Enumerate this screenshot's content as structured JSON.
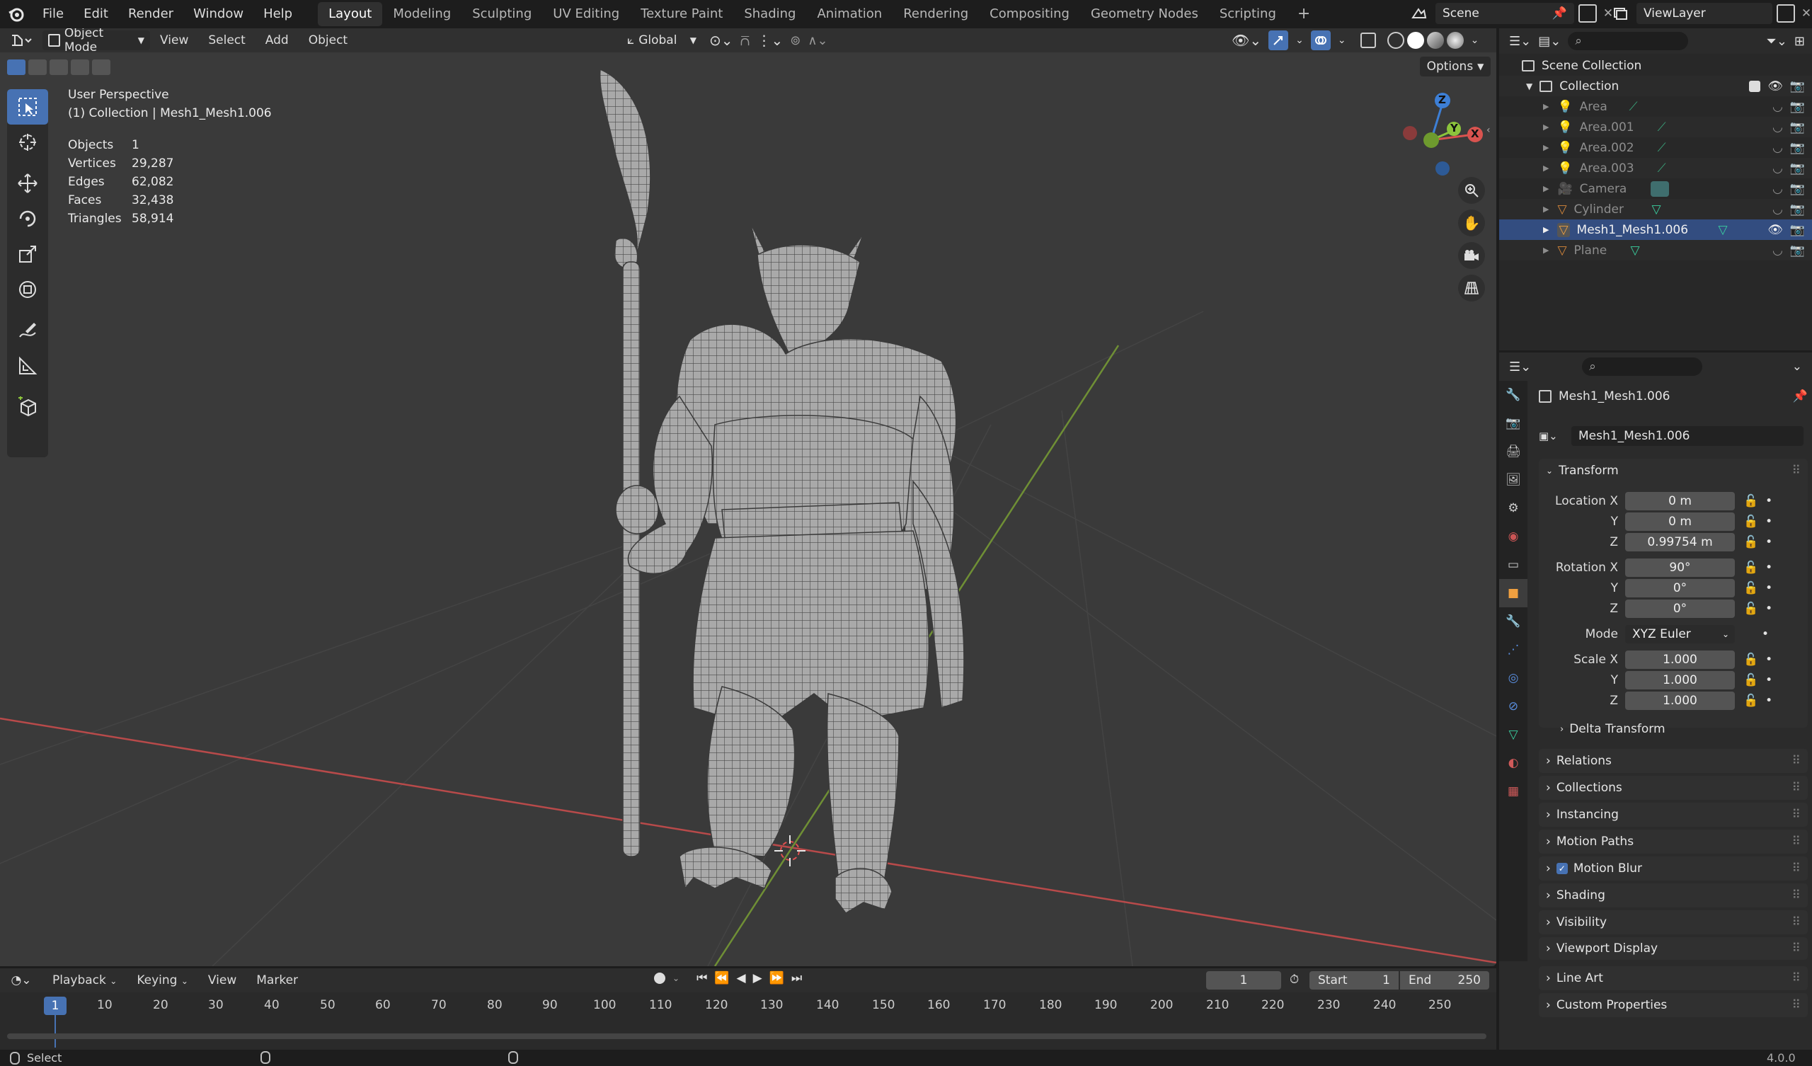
{
  "menu": {
    "file": "File",
    "edit": "Edit",
    "render": "Render",
    "window": "Window",
    "help": "Help"
  },
  "workspaces": [
    {
      "label": "Layout",
      "active": true
    },
    {
      "label": "Modeling",
      "active": false
    },
    {
      "label": "Sculpting",
      "active": false
    },
    {
      "label": "UV Editing",
      "active": false
    },
    {
      "label": "Texture Paint",
      "active": false
    },
    {
      "label": "Shading",
      "active": false
    },
    {
      "label": "Animation",
      "active": false
    },
    {
      "label": "Rendering",
      "active": false
    },
    {
      "label": "Compositing",
      "active": false
    },
    {
      "label": "Geometry Nodes",
      "active": false
    },
    {
      "label": "Scripting",
      "active": false
    }
  ],
  "add_workspace": "+",
  "scene": {
    "name": "Scene",
    "view_layer": "ViewLayer"
  },
  "viewport": {
    "mode": "Object Mode",
    "menus": [
      "View",
      "Select",
      "Add",
      "Object"
    ],
    "orientation": "Global",
    "options": "Options",
    "view_name": "User Perspective",
    "collection_info": "(1) Collection | Mesh1_Mesh1.006",
    "stats": [
      {
        "key": "Objects",
        "value": "1"
      },
      {
        "key": "Vertices",
        "value": "29,287"
      },
      {
        "key": "Edges",
        "value": "62,082"
      },
      {
        "key": "Faces",
        "value": "32,438"
      },
      {
        "key": "Triangles",
        "value": "58,914"
      }
    ],
    "gizmo": {
      "x": "X",
      "y": "Y",
      "z": "Z"
    }
  },
  "outliner": {
    "scene_collection": "Scene Collection",
    "collection": "Collection",
    "items": [
      {
        "name": "Area",
        "type": "light"
      },
      {
        "name": "Area.001",
        "type": "light"
      },
      {
        "name": "Area.002",
        "type": "light"
      },
      {
        "name": "Area.003",
        "type": "light"
      },
      {
        "name": "Camera",
        "type": "camera"
      },
      {
        "name": "Cylinder",
        "type": "mesh"
      },
      {
        "name": "Mesh1_Mesh1.006",
        "type": "mesh",
        "active": true
      },
      {
        "name": "Plane",
        "type": "mesh"
      }
    ]
  },
  "properties": {
    "object_name": "Mesh1_Mesh1.006",
    "object_field": "Mesh1_Mesh1.006",
    "transform_title": "Transform",
    "location": {
      "label": "Location X",
      "x": "0 m",
      "y": "0 m",
      "z": "0.99754 m"
    },
    "rotation": {
      "label": "Rotation X",
      "x": "90°",
      "y": "0°",
      "z": "0°"
    },
    "mode": {
      "label": "Mode",
      "value": "XYZ Euler"
    },
    "scale": {
      "label": "Scale X",
      "x": "1.000",
      "y": "1.000",
      "z": "1.000"
    },
    "axis_y": "Y",
    "axis_z": "Z",
    "delta_transform": "Delta Transform",
    "panels": [
      "Relations",
      "Collections",
      "Instancing",
      "Motion Paths",
      "Motion Blur",
      "Shading",
      "Visibility",
      "Viewport Display",
      "Line Art",
      "Custom Properties"
    ]
  },
  "timeline": {
    "menus": [
      "Playback",
      "Keying",
      "View",
      "Marker"
    ],
    "current_frame": "1",
    "start_label": "Start",
    "start": "1",
    "end_label": "End",
    "end": "250",
    "ticks": [
      "1",
      "10",
      "20",
      "30",
      "40",
      "50",
      "60",
      "70",
      "80",
      "90",
      "100",
      "110",
      "120",
      "130",
      "140",
      "150",
      "160",
      "170",
      "180",
      "190",
      "200",
      "210",
      "220",
      "230",
      "240",
      "250"
    ]
  },
  "status": {
    "select": "Select",
    "version": "4.0.0"
  },
  "colors": {
    "accent": "#4772b3",
    "x_axis": "#d9534f",
    "y_axis": "#8cc43c",
    "z_axis": "#3d7fd6"
  }
}
